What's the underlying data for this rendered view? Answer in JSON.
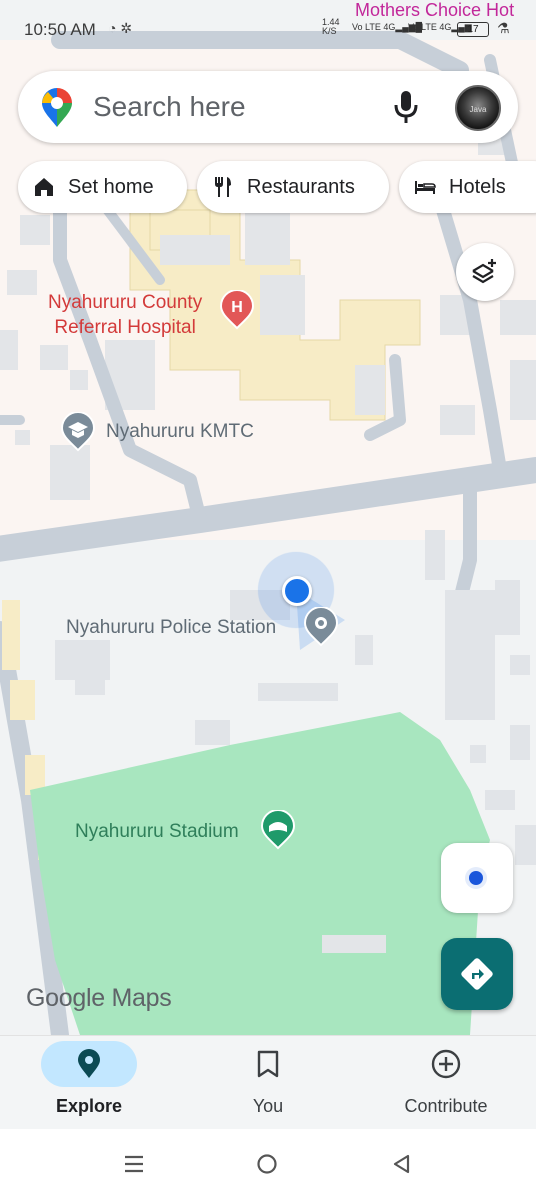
{
  "status_bar": {
    "time": "10:50 AM",
    "net_speed": "1.44",
    "net_speed_unit": "K/S",
    "sim1_label": "Vo LTE",
    "sim1_type": "4G",
    "sim2_label": "Vo LTE",
    "sim2_type": "4G",
    "battery": "17"
  },
  "map_overlay_text": "Mothers Choice Hot",
  "search": {
    "placeholder": "Search here",
    "avatar_text": "Java"
  },
  "chips": [
    {
      "label": "Set home",
      "icon": "home-icon"
    },
    {
      "label": "Restaurants",
      "icon": "fork-knife-icon"
    },
    {
      "label": "Hotels",
      "icon": "bed-icon"
    }
  ],
  "places": {
    "hospital_line1": "Nyahururu County",
    "hospital_line2": "Referral Hospital",
    "kmtc": "Nyahururu KMTC",
    "police": "Nyahururu Police Station",
    "stadium": "Nyahururu Stadium"
  },
  "logo": {
    "google": "Google",
    "maps": "Maps"
  },
  "bottom_nav": {
    "explore": "Explore",
    "you": "You",
    "contribute": "Contribute"
  },
  "colors": {
    "accent": "#0b6e72",
    "hospital_text": "#d33a3a",
    "stadium_green": "#a8e6bf",
    "location_blue": "#1a73e8",
    "explore_pill": "#c2e7ff"
  }
}
